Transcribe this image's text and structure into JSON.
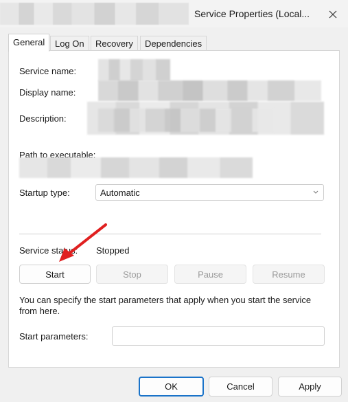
{
  "window": {
    "title": "Service Properties (Local..."
  },
  "tabs": [
    {
      "label": "General"
    },
    {
      "label": "Log On"
    },
    {
      "label": "Recovery"
    },
    {
      "label": "Dependencies"
    }
  ],
  "general": {
    "service_name_label": "Service name:",
    "display_name_label": "Display name:",
    "description_label": "Description:",
    "path_label": "Path to executable:",
    "startup_type_label": "Startup type:",
    "startup_type_value": "Automatic",
    "service_status_label": "Service status:",
    "service_status_value": "Stopped",
    "buttons": {
      "start": "Start",
      "stop": "Stop",
      "pause": "Pause",
      "resume": "Resume"
    },
    "hint_line1": "You can specify the start parameters that apply when you start the service",
    "hint_line2": "from here.",
    "start_params_label": "Start parameters:"
  },
  "footer": {
    "ok": "OK",
    "cancel": "Cancel",
    "apply": "Apply"
  },
  "colors": {
    "accent": "#1a73c9",
    "annotation_arrow": "#e02020"
  },
  "icons": {
    "close": "close-icon",
    "dropdown": "chevron-down-icon",
    "annotation": "red-arrow-annotation"
  }
}
